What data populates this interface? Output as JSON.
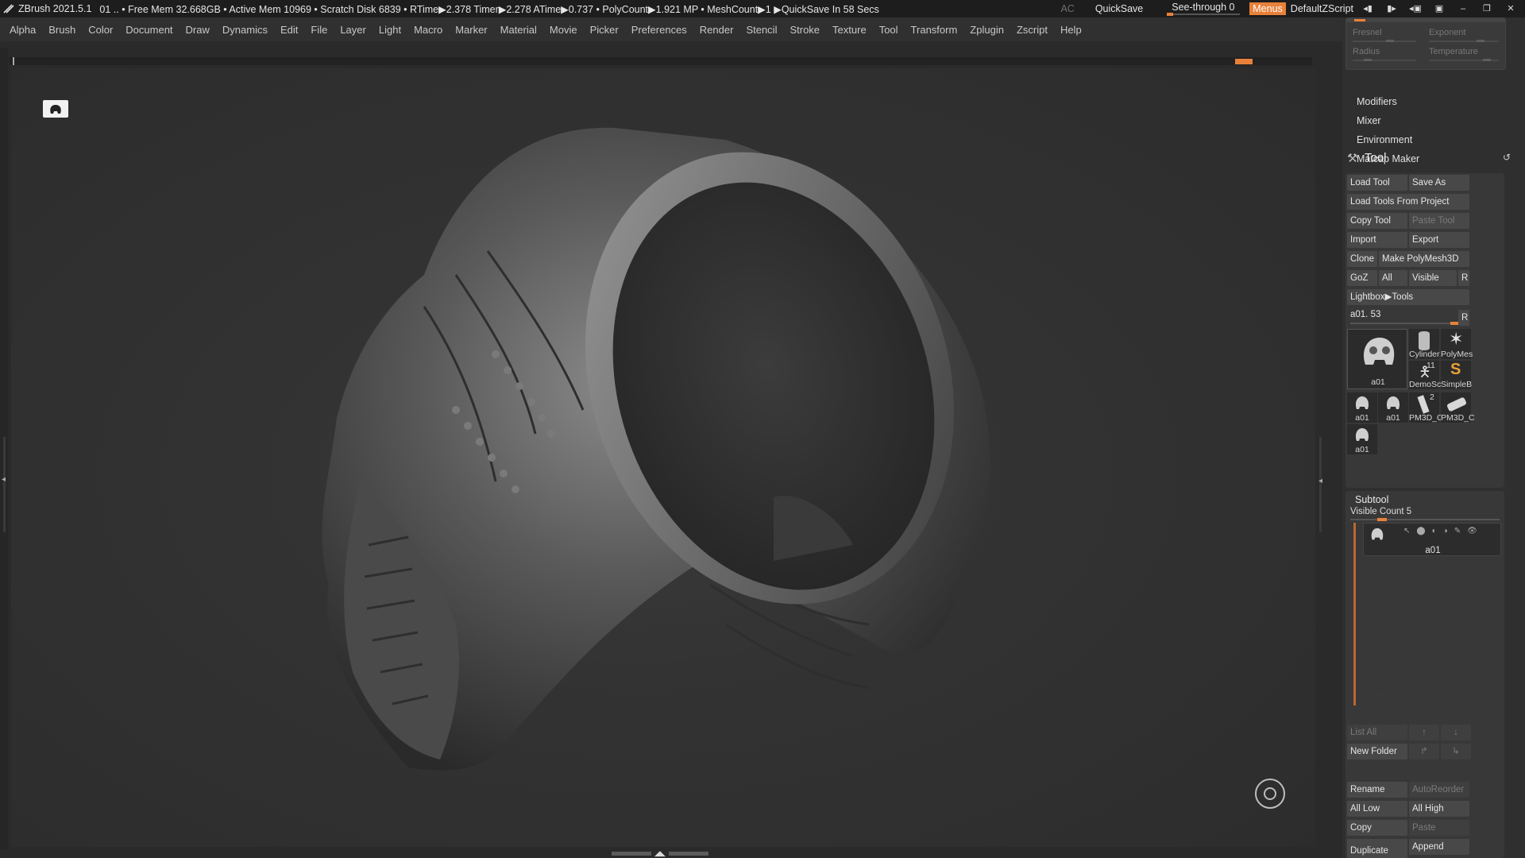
{
  "titlebar": {
    "app": "ZBrush 2021.5.1",
    "status": "01   .. • Free Mem 32.668GB • Active Mem 10969 • Scratch Disk 6839 •  RTime▶2.378 Timer▶2.278 ATime▶0.737 • PolyCount▶1.921 MP  • MeshCount▶1  ▶QuickSave In 58 Secs",
    "ac": "AC",
    "quicksave": "QuickSave",
    "seethrough": "See-through   0",
    "menus": "Menus",
    "defaultzscript": "DefaultZScript",
    "accent": "#e8813a"
  },
  "menubar": [
    "Alpha",
    "Brush",
    "Color",
    "Document",
    "Draw",
    "Dynamics",
    "Edit",
    "File",
    "Layer",
    "Light",
    "Macro",
    "Marker",
    "Material",
    "Movie",
    "Picker",
    "Preferences",
    "Render",
    "Stencil",
    "Stroke",
    "Texture",
    "Tool",
    "Transform",
    "Zplugin",
    "Zscript",
    "Help"
  ],
  "lightbox_top": {
    "fresnel": "Fresnel",
    "exponent": "Exponent",
    "radius": "Radius",
    "temperature": "Temperature"
  },
  "sub_items": [
    "Modifiers",
    "Mixer",
    "Environment",
    "Matcap Maker"
  ],
  "tool": {
    "title": "Tool",
    "load_tool": "Load Tool",
    "save_as": "Save As",
    "load_from_project": "Load Tools From Project",
    "copy_tool": "Copy Tool",
    "paste_tool": "Paste Tool",
    "import": "Import",
    "export": "Export",
    "clone": "Clone",
    "make_polymesh": "Make PolyMesh3D",
    "goz": "GoZ",
    "all": "All",
    "visible": "Visible",
    "r": "R",
    "lightbox_tools": "Lightbox▶Tools",
    "current": "a01. 53",
    "r2": "R",
    "thumbs": {
      "big": "a01",
      "cylinder": "Cylinder",
      "polymesh": "PolyMes",
      "demo": "DemoSc",
      "simpleb": "SimpleB",
      "demo_count": "11",
      "s1": "a01",
      "s2": "a01",
      "pm1": "PM3D_C",
      "pm2": "PM3D_C",
      "pm_count": "2",
      "s3": "a01"
    }
  },
  "subtool": {
    "title": "Subtool",
    "visible_count": "Visible Count 5",
    "item": "a01",
    "list_all": "List All",
    "new_folder": "New Folder",
    "rename": "Rename",
    "autoreorder": "AutoReorder",
    "all_low": "All Low",
    "all_high": "All High",
    "copy": "Copy",
    "paste": "Paste",
    "duplicate": "Duplicate",
    "append": "Append"
  }
}
